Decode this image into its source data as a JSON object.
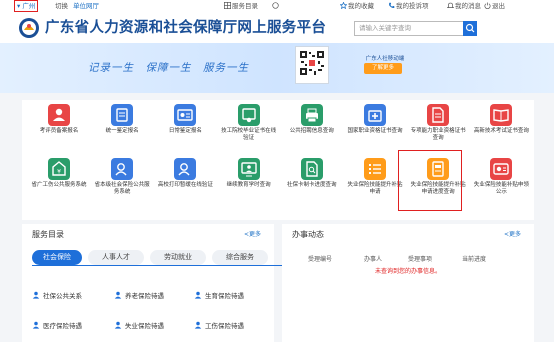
{
  "topbar": {
    "city": "广州",
    "switch": "切换",
    "unit_version": "单位网厅",
    "service_dir": "服务目录",
    "favorites": "我的收藏",
    "my_report": "我的投诉项",
    "notice": "我的消息",
    "logout": "退出"
  },
  "header": {
    "site_title": "广东省人力资源和社会保障厅网上服务平台",
    "search_placeholder": "请输入关键字查询"
  },
  "banner": {
    "slogan": "记录一生　保障一生　服务一生",
    "qr_label": "广东人社移动端",
    "qr_button": "了解更多"
  },
  "services": [
    {
      "label": "考评员备案报名",
      "color": "#e84545",
      "icon": "person-icon"
    },
    {
      "label": "统一鉴定报名",
      "color": "#3b7be0",
      "icon": "edit-icon"
    },
    {
      "label": "日常鉴定报名",
      "color": "#3b7be0",
      "icon": "id-card-icon"
    },
    {
      "label": "技工院校毕业证书在线验证",
      "color": "#2a9d6a",
      "icon": "certificate-icon"
    },
    {
      "label": "公共招聘信息查询",
      "color": "#2a9d6a",
      "icon": "printer-icon"
    },
    {
      "label": "国家职业资格证书查询",
      "color": "#3b7be0",
      "icon": "medical-box-icon"
    },
    {
      "label": "专项能力职业资格证书查询",
      "color": "#e84545",
      "icon": "document-icon"
    },
    {
      "label": "高新技术考试证书查询",
      "color": "#e84545",
      "icon": "book-icon"
    },
    {
      "label": "省广工伤公共服务系统",
      "color": "#2a9d6a",
      "icon": "money-icon"
    },
    {
      "label": "省本级社会保险公共服务系统",
      "color": "#3b7be0",
      "icon": "user-search-icon"
    },
    {
      "label": "高校打印暂缓在线验证",
      "color": "#3b7be0",
      "icon": "user-search-icon"
    },
    {
      "label": "继续教育学时查询",
      "color": "#2a9d6a",
      "icon": "monitor-user-icon"
    },
    {
      "label": "社保卡制卡进度查询",
      "color": "#2a9d6a",
      "icon": "file-search-icon"
    },
    {
      "label": "失业保险技能提升补贴申请",
      "color": "#ff9c1a",
      "icon": "checklist-icon"
    },
    {
      "label": "失业保险技能提升补贴申请进度查询",
      "color": "#ff9c1a",
      "icon": "document-search-icon"
    },
    {
      "label": "失业保险技能补贴申领公示",
      "color": "#e84545",
      "icon": "card-icon"
    }
  ],
  "service_dir": {
    "title": "服务目录",
    "more": "更多",
    "tabs": [
      "社会保险",
      "人事人才",
      "劳动就业",
      "综合服务"
    ],
    "links": [
      "社保公共关系",
      "养老保险待遇",
      "生育保险待遇",
      "医疗保险待遇",
      "失业保险待遇",
      "工伤保险待遇"
    ]
  },
  "affairs": {
    "title": "办事动态",
    "more": "更多",
    "columns": [
      "受理编号",
      "办事人",
      "受理事项",
      "当前进度"
    ],
    "empty": "未查询到您的办事信息。"
  },
  "colors": {
    "primary": "#1e6fd9",
    "title": "#1a4f96",
    "highlight": "#e02020",
    "orange": "#ff9c1a"
  }
}
